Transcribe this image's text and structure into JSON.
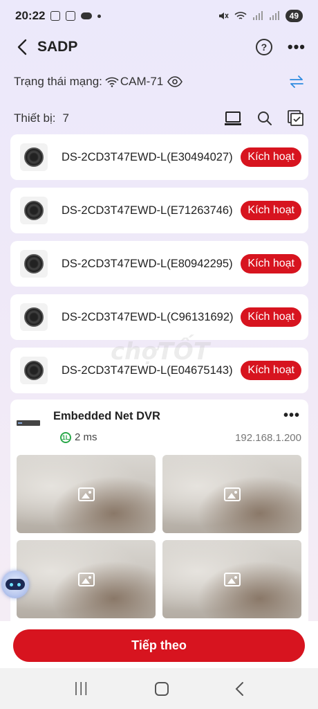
{
  "status_bar": {
    "time": "20:22",
    "battery": "49"
  },
  "header": {
    "title": "SADP",
    "help_label": "?",
    "more_label": "•••"
  },
  "network": {
    "label": "Trạng thái mạng:",
    "name": "CAM-71"
  },
  "devices_summary": {
    "label": "Thiết bị:",
    "count": "7"
  },
  "devices": [
    {
      "name": "DS-2CD3T47EWD-L(E30494027)",
      "action": "Kích hoạt"
    },
    {
      "name": "DS-2CD3T47EWD-L(E71263746)",
      "action": "Kích hoạt"
    },
    {
      "name": "DS-2CD3T47EWD-L(E80942295)",
      "action": "Kích hoạt"
    },
    {
      "name": "DS-2CD3T47EWD-L(C96131692)",
      "action": "Kích hoạt"
    },
    {
      "name": "DS-2CD3T47EWD-L(E04675143)",
      "action": "Kích hoạt"
    }
  ],
  "dvr": {
    "title": "Embedded Net DVR",
    "latency": "2 ms",
    "ip": "192.168.1.200",
    "more_label": "•••"
  },
  "watermark": "chợTỐT",
  "footer": {
    "next_label": "Tiếp theo"
  },
  "colors": {
    "accent": "#d7141f",
    "link_blue": "#2d8ae0",
    "latency_green": "#2aa84a"
  },
  "icons": [
    "back-arrow-icon",
    "help-icon",
    "more-icon",
    "wifi-icon",
    "eye-icon",
    "switch-arrows-icon",
    "laptop-icon",
    "search-icon",
    "select-all-icon",
    "camera-icon",
    "dvr-icon",
    "latency-icon",
    "image-placeholder-icon",
    "assistant-robot-icon"
  ]
}
